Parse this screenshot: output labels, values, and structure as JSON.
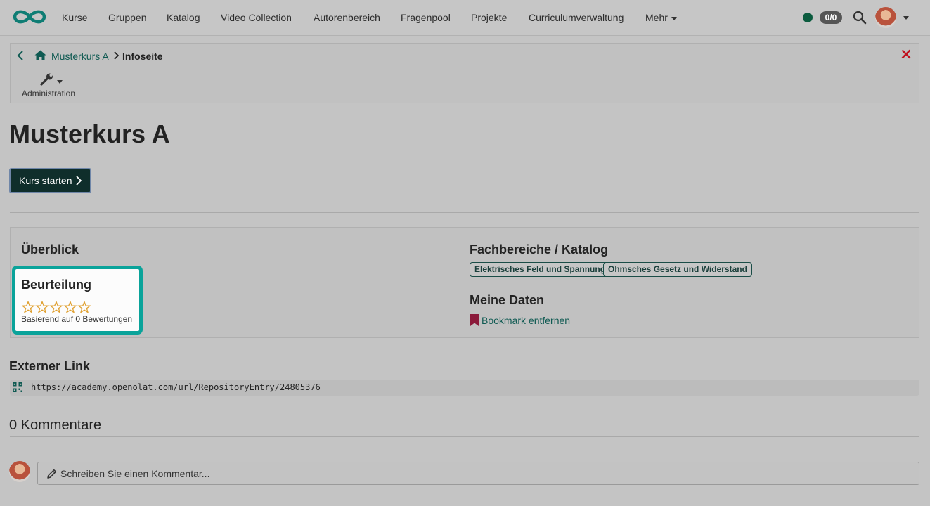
{
  "colors": {
    "brand": "#0f7d74",
    "link": "#0f5a52",
    "primary_button": "#0f2e2b",
    "rating_card_border": "#0aa39a",
    "close": "#c0121f",
    "bookmark": "#8b1a3a",
    "status_online": "#0b5b3e",
    "star_outline": "#e0a030"
  },
  "navbar": {
    "logo_icon": "openolat-infinity-logo",
    "items": [
      {
        "label": "Kurse"
      },
      {
        "label": "Gruppen"
      },
      {
        "label": "Katalog"
      },
      {
        "label": "Video Collection"
      },
      {
        "label": "Autorenbereich"
      },
      {
        "label": "Fragenpool"
      },
      {
        "label": "Projekte"
      },
      {
        "label": "Curriculumverwaltung"
      }
    ],
    "more_label": "Mehr",
    "badge": "0/0",
    "icons": [
      "status-dot",
      "search-icon",
      "user-avatar",
      "chevron-down-icon"
    ]
  },
  "breadcrumb": {
    "course": "Musterkurs A",
    "current": "Infoseite",
    "icons": [
      "chevron-left-icon",
      "home-icon",
      "chevron-right-icon",
      "close-icon"
    ]
  },
  "toolbar": {
    "admin_label": "Administration",
    "admin_icon": "wrench-icon"
  },
  "main": {
    "title": "Musterkurs A",
    "start_button": "Kurs starten"
  },
  "overview": {
    "title": "Überblick",
    "rating": {
      "title": "Beurteilung",
      "stars_filled": 0,
      "stars_total": 5,
      "subtitle": "Basierend auf 0 Bewertungen"
    },
    "catalog": {
      "title": "Fachbereiche / Katalog",
      "tags": [
        "Elektrisches Feld und Spannung",
        "Ohmsches Gesetz und Widerstand"
      ]
    },
    "my_data": {
      "title": "Meine Daten",
      "bookmark_label": "Bookmark entfernen",
      "bookmark_icon": "bookmark-icon"
    }
  },
  "external_link": {
    "title": "Externer Link",
    "url": "https://academy.openolat.com/url/RepositoryEntry/24805376",
    "icon": "qr-code-icon"
  },
  "comments": {
    "title": "0 Kommentare",
    "placeholder": "Schreiben Sie einen Kommentar...",
    "icon": "pencil-icon"
  }
}
